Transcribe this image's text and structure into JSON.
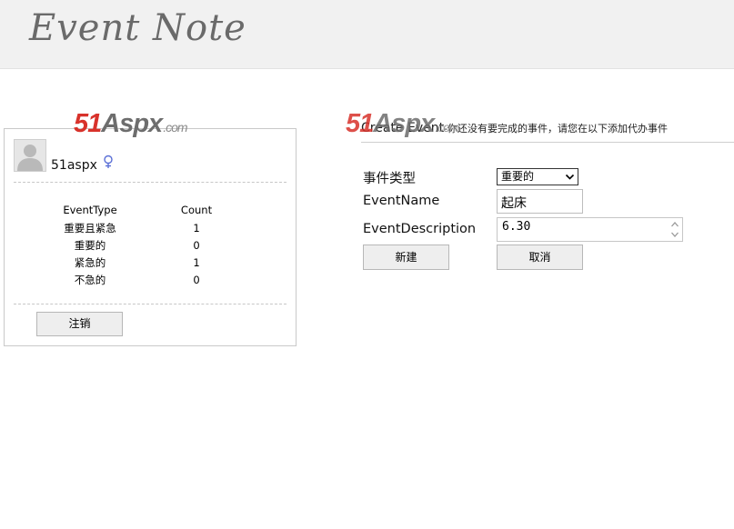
{
  "header": {
    "title": "Event Note"
  },
  "watermark": {
    "part1": "51",
    "part2": "Aspx",
    "domain": ".com"
  },
  "user": {
    "name": "51aspx"
  },
  "stats": {
    "headers": [
      "EventType",
      "Count"
    ],
    "rows": [
      {
        "type": "重要且紧急",
        "count": "1"
      },
      {
        "type": "重要的",
        "count": "0"
      },
      {
        "type": "紧急的",
        "count": "1"
      },
      {
        "type": "不急的",
        "count": "0"
      }
    ]
  },
  "logout_label": "注销",
  "create": {
    "title": "Create Event",
    "hint": "-你还没有要完成的事件，请您在以下添加代办事件",
    "type_label": "事件类型",
    "type_value": "重要的",
    "name_label": "EventName",
    "name_value": "起床",
    "desc_label": "EventDescription",
    "desc_value": "6.30",
    "create_label": "新建",
    "cancel_label": "取消"
  }
}
